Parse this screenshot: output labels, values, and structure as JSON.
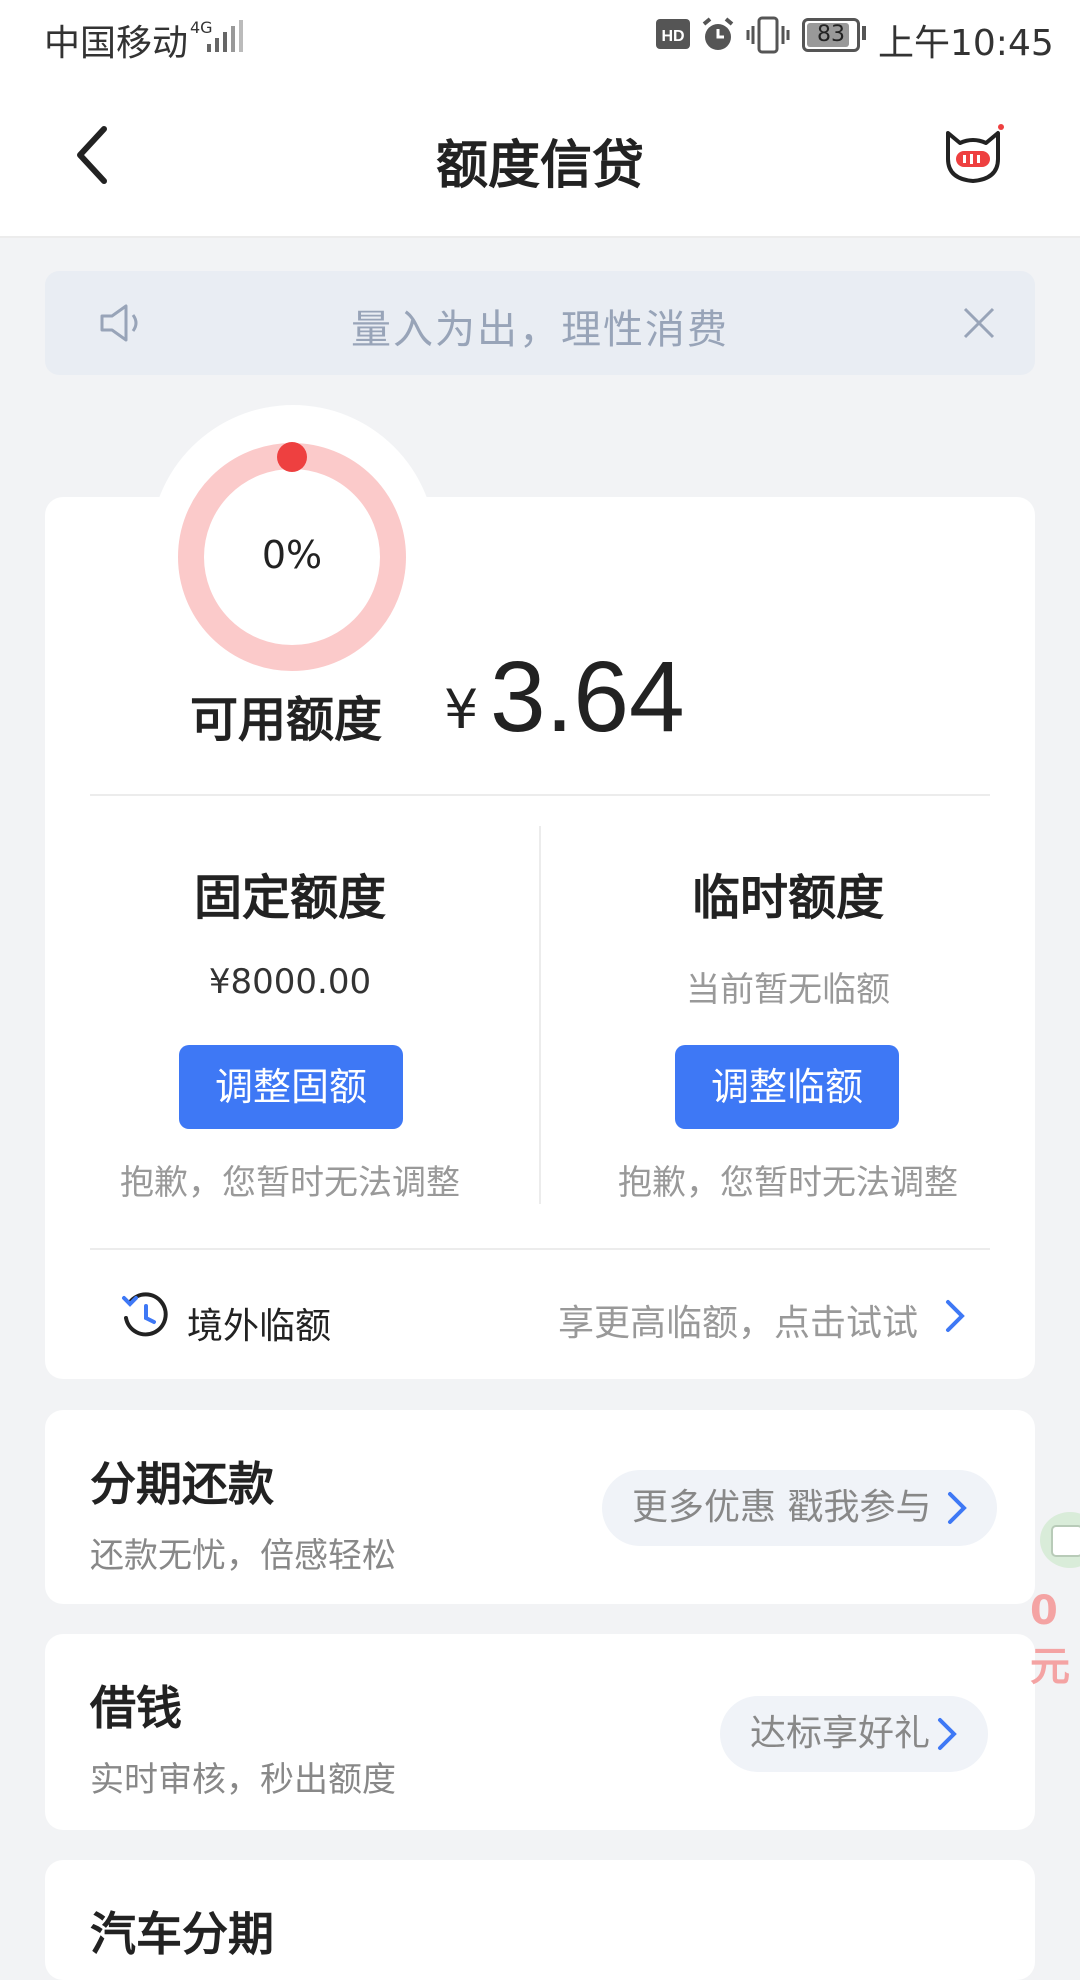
{
  "status_bar": {
    "carrier": "中国移动",
    "network": "4G",
    "battery": "83",
    "time": "上午10:45"
  },
  "nav": {
    "title": "额度信贷"
  },
  "notice": {
    "text": "量入为出，理性消费"
  },
  "credit": {
    "usage_percent": "0%",
    "available_label": "可用额度",
    "currency_symbol": "¥",
    "available_amount": "3.64",
    "fixed": {
      "title": "固定额度",
      "amount": "¥8000.00",
      "button": "调整固额",
      "note": "抱歉，您暂时无法调整"
    },
    "temporary": {
      "title": "临时额度",
      "amount": "当前暂无临额",
      "button": "调整临额",
      "note": "抱歉，您暂时无法调整"
    },
    "overseas": {
      "label": "境外临额",
      "hint": "享更高临额，点击试试"
    }
  },
  "installments": {
    "title": "分期还款",
    "subtitle": "还款无忧，倍感轻松",
    "promo": "更多优惠 戳我参与"
  },
  "borrow": {
    "title": "借钱",
    "subtitle": "实时审核，秒出额度",
    "promo": "达标享好礼"
  },
  "car_installments": {
    "title": "汽车分期"
  },
  "float_ad": {
    "text": "0元"
  },
  "colors": {
    "primary_blue": "#3e78f5",
    "ring_light": "#fbcaca",
    "ring_dot": "#ee4040",
    "notice_bg": "#e9edf3"
  }
}
